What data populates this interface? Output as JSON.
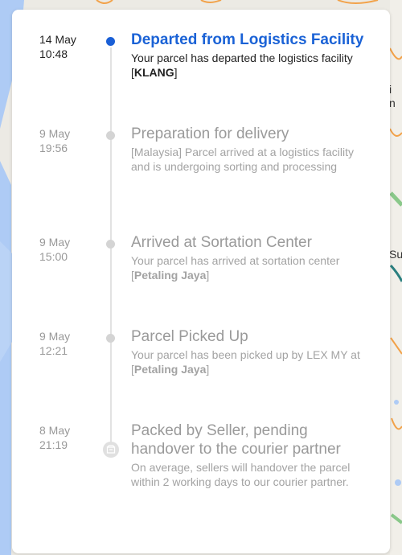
{
  "map": {
    "labels": [
      "i",
      "n",
      "Su"
    ]
  },
  "events": [
    {
      "date": "14 May",
      "time": "10:48",
      "title": "Departed from Logistics Facility",
      "desc_prefix": "Your parcel has departed the logistics facility [",
      "desc_bold": "KLANG",
      "desc_suffix": "]",
      "active": true
    },
    {
      "date": "9 May",
      "time": "19:56",
      "title": "Preparation for delivery",
      "desc": "[Malaysia] Parcel arrived at a logistics facility and is undergoing sorting and processing",
      "active": false
    },
    {
      "date": "9 May",
      "time": "15:00",
      "title": "Arrived at Sortation Center",
      "desc_prefix": "Your parcel has arrived at sortation center [",
      "desc_bold": "Petaling Jaya",
      "desc_suffix": "]",
      "active": false
    },
    {
      "date": "9 May",
      "time": "12:21",
      "title": "Parcel Picked Up",
      "desc_prefix": "Your parcel has been picked up by LEX MY at [",
      "desc_bold": "Petaling Jaya",
      "desc_suffix": "]",
      "active": false
    },
    {
      "date": "8 May",
      "time": "21:19",
      "title": "Packed by Seller, pending handover to the courier partner",
      "desc": "On average, sellers will handover the parcel within 2 working days to our courier partner.",
      "active": false,
      "icon": "package-icon"
    }
  ],
  "colors": {
    "active_blue": "#1a62d6",
    "inactive_gray": "#9a9a9a",
    "dot_gray": "#d4d4d4"
  }
}
